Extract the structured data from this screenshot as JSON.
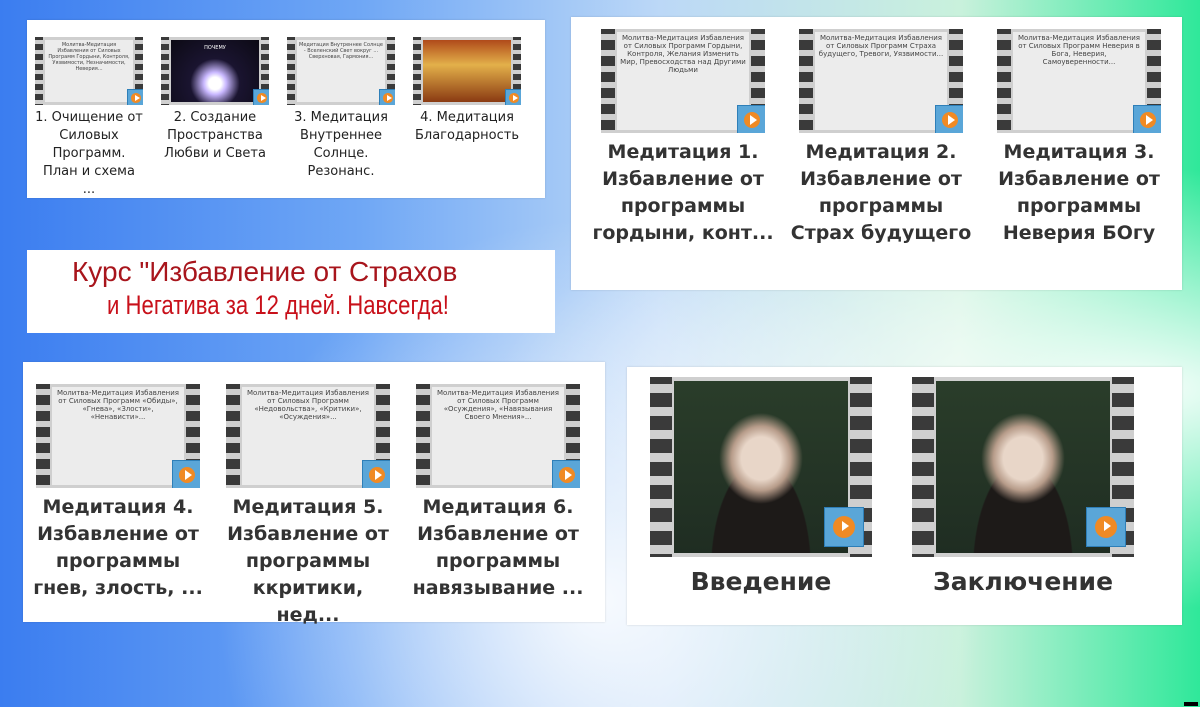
{
  "panel_top_left": {
    "items": [
      {
        "caption": "1. Очищение  от Силовых Программ. План и схема ...",
        "thumb_text": "Молитва-Медитация Избавления от Силовых Программ Гордыни, Контроля, Уязвимости, Незначимости, Неверия..."
      },
      {
        "caption": "2. Создание Пространства Любви и Света",
        "thumb_text": "ПОЧЕМУ"
      },
      {
        "caption": "3. Медитация Внутреннее Солнце. Резонанс.",
        "thumb_text": "Медитация Внутреннее Солнце - Вселенский Свет вокруг ... Сверхновая, Гармония..."
      },
      {
        "caption": "4. Медитация Благодарность",
        "thumb_text": ""
      }
    ]
  },
  "panel_top_right": {
    "items": [
      {
        "caption": "Медитация 1. Избавление от программы гордыни, конт...",
        "thumb_text": "Молитва-Медитация Избавления от Силовых Программ Гордыни, Контроля, Желания Изменить Мир, Превосходства над Другими Людьми"
      },
      {
        "caption": "Медитация 2. Избавление от программы Страх будущего",
        "thumb_text": "Молитва-Медитация Избавления от Силовых Программ Страха будущего, Тревоги, Уязвимости..."
      },
      {
        "caption": "Медитация 3. Избавление от программы Неверия БОгу",
        "thumb_text": "Молитва-Медитация Избавления от Силовых Программ Неверия в Бога, Неверия, Самоуверенности..."
      }
    ]
  },
  "title": {
    "line1": "Курс \"Избавление от Страхов",
    "line2": "и Негатива за 12 дней. Навсегда!"
  },
  "panel_bottom_left": {
    "items": [
      {
        "caption": "Медитация 4. Избавление от программы гнев, злость, ...",
        "thumb_text": "Молитва-Медитация Избавления от Силовых Программ «Обиды», «Гнева», «Злости», «Ненависти»..."
      },
      {
        "caption": "Медитация 5. Избавление от программы ккритики, нед...",
        "thumb_text": "Молитва-Медитация Избавления от Силовых Программ «Недовольства», «Критики», «Осуждения»..."
      },
      {
        "caption": "Медитация 6. Избавление от программы навязывание ...",
        "thumb_text": "Молитва-Медитация Избавления от Силовых Программ «Осуждения», «Навязывания Своего Мнения»..."
      }
    ]
  },
  "panel_bottom_right": {
    "items": [
      {
        "caption": "Введение"
      },
      {
        "caption": "Заключение"
      }
    ]
  },
  "colors": {
    "title_dark_red": "#a8151c",
    "title_red": "#c8101a",
    "play_orange": "#f08a24",
    "play_blue": "#5aa6d8"
  }
}
